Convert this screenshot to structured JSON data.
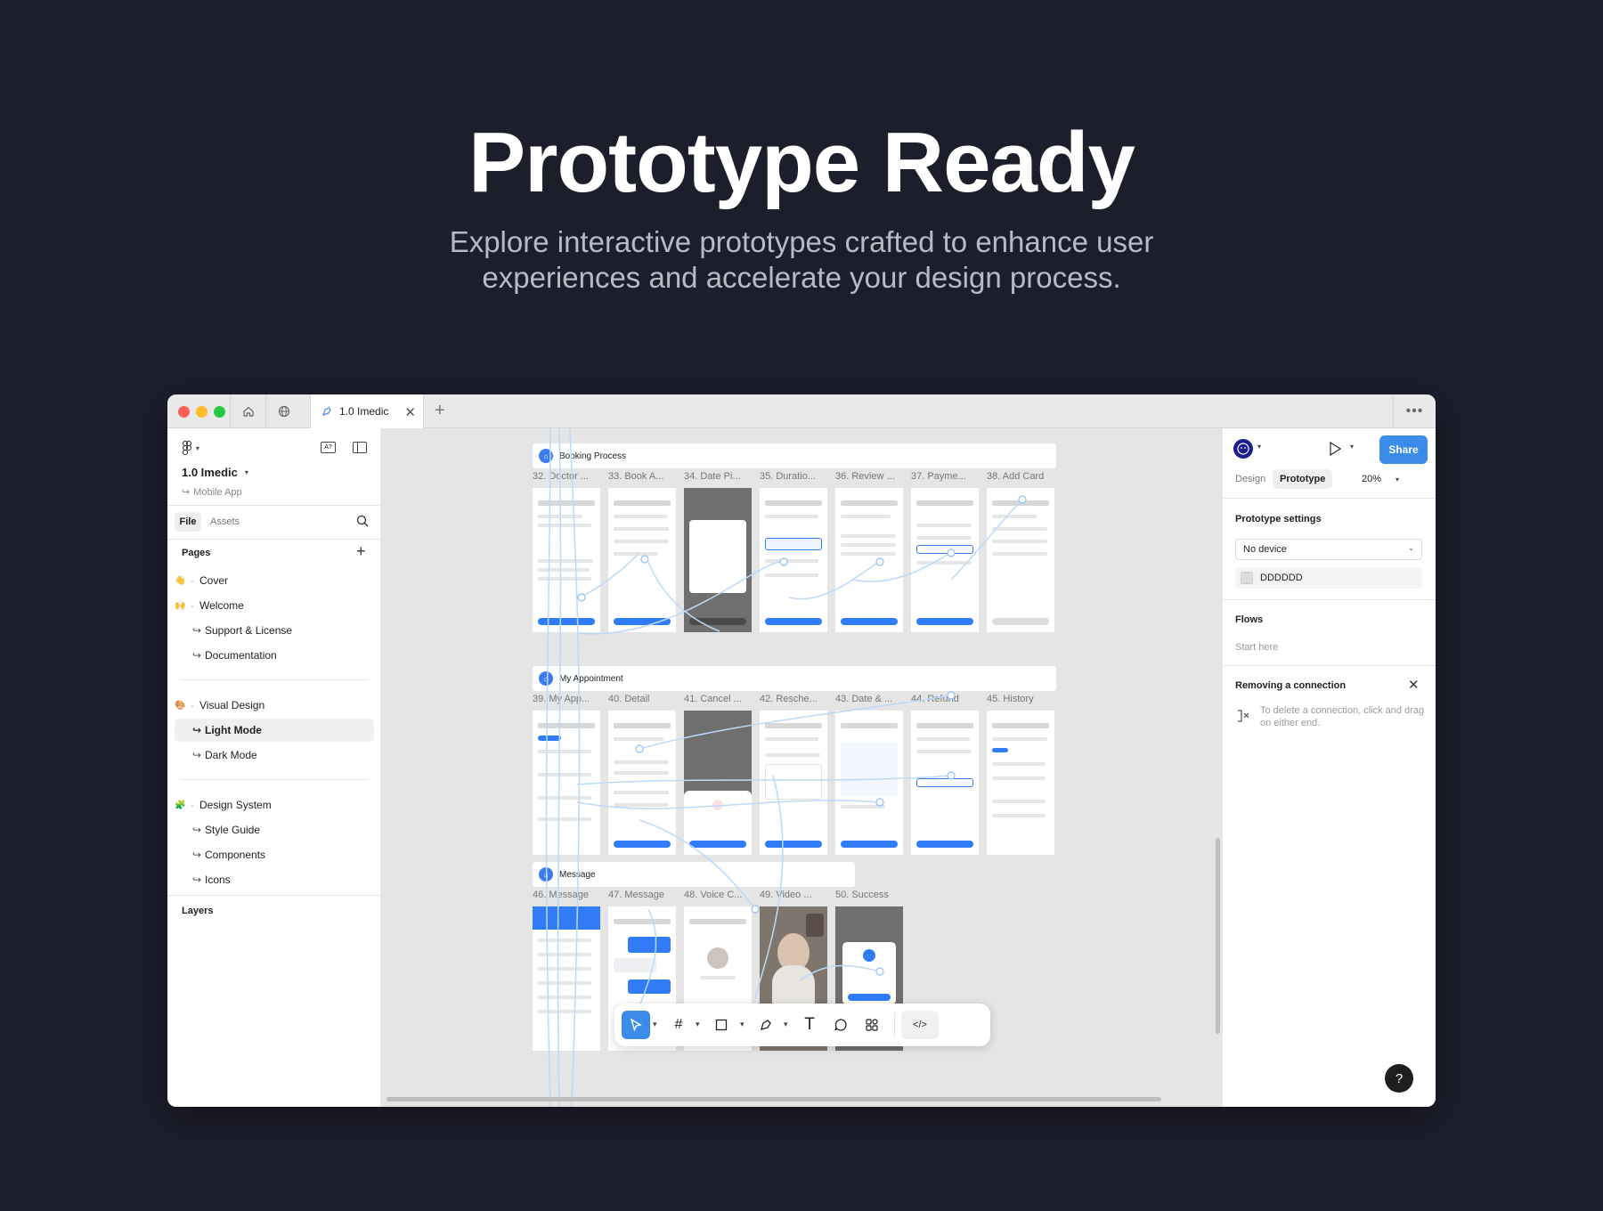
{
  "hero": {
    "title": "Prototype Ready",
    "subtitle": "Explore interactive prototypes crafted to enhance user experiences and accelerate your design process."
  },
  "window": {
    "tab_title": "1.0 Imedic"
  },
  "left_panel": {
    "file_name": "1.0 Imedic",
    "file_sub": "Mobile App",
    "tabs": {
      "file": "File",
      "assets": "Assets"
    },
    "pages_heading": "Pages",
    "pages": [
      {
        "label": "Cover",
        "emoji": "👋",
        "dot": true
      },
      {
        "label": "Welcome",
        "emoji": "🙌",
        "dot": true
      },
      {
        "label": "Support & License",
        "emoji": "",
        "dot": false
      },
      {
        "label": "Documentation",
        "emoji": "",
        "dot": false
      },
      {
        "label": "Visual Design",
        "emoji": "🎨",
        "dot": true
      },
      {
        "label": "Light Mode",
        "emoji": "",
        "dot": false
      },
      {
        "label": "Dark Mode",
        "emoji": "",
        "dot": false
      },
      {
        "label": "Design System",
        "emoji": "🧩",
        "dot": true
      },
      {
        "label": "Style Guide",
        "emoji": "",
        "dot": false
      },
      {
        "label": "Components",
        "emoji": "",
        "dot": false
      },
      {
        "label": "Icons",
        "emoji": "",
        "dot": false
      }
    ],
    "layers_heading": "Layers"
  },
  "canvas": {
    "sections": [
      {
        "title": "Booking Process",
        "frames": [
          "32. Doctor ...",
          "33. Book A...",
          "34. Date Pi...",
          "35. Duratio...",
          "36. Review ...",
          "37. Payme...",
          "38. Add Card"
        ]
      },
      {
        "title": "My Appointment",
        "frames": [
          "39. My App...",
          "40. Detail",
          "41. Cancel ...",
          "42. Resche...",
          "43. Date & ...",
          "44. Refund",
          "45. History"
        ]
      },
      {
        "title": "Message",
        "frames": [
          "46. Message",
          "47. Message",
          "48. Voice C...",
          "49. Video ...",
          "50. Success"
        ]
      }
    ]
  },
  "right_panel": {
    "tab_design": "Design",
    "tab_prototype": "Prototype",
    "zoom": "20%",
    "share_label": "Share",
    "prototype_settings_heading": "Prototype settings",
    "device_value": "No device",
    "bg_color_value": "DDDDDD",
    "flows_heading": "Flows",
    "flows_start": "Start here",
    "removing_heading": "Removing a connection",
    "removing_text": "To delete a connection, click and drag on either end.",
    "help_label": "?"
  },
  "colors": {
    "page_bg": "#1d1e2c",
    "accent_blue": "#3b8be8",
    "canvas_bg": "#e5e5e5",
    "prototype_noodle": "#bcd9f7"
  }
}
